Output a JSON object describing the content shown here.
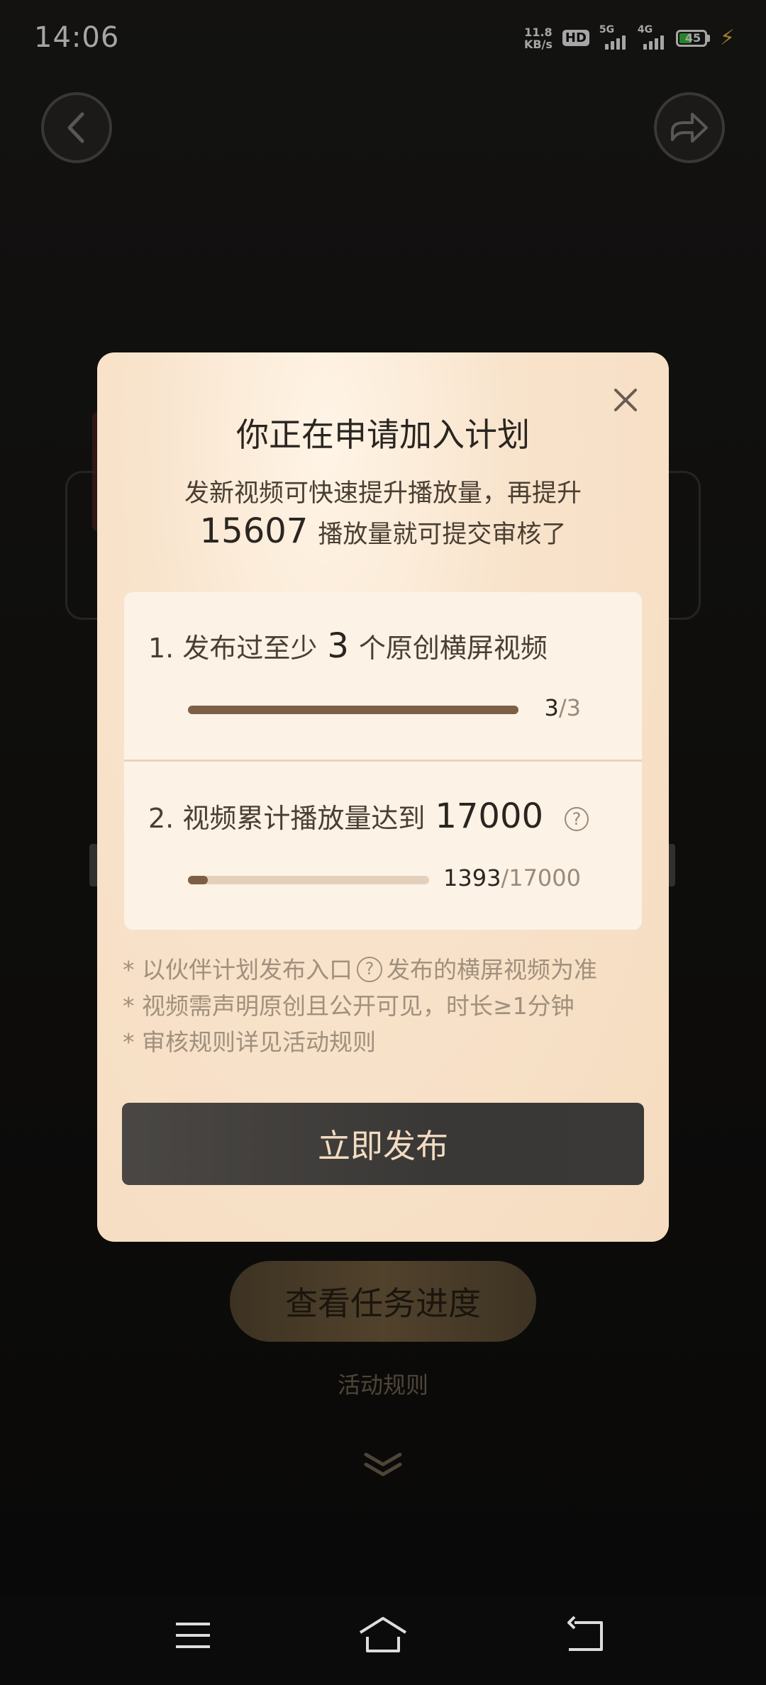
{
  "status_bar": {
    "time": "14:06",
    "net_speed_value": "11.8",
    "net_speed_unit": "KB/s",
    "hd_label": "HD",
    "sim1_label": "5G",
    "sim2_label": "4G",
    "battery_level": "45"
  },
  "background": {
    "task_progress_button": "查看任务进度",
    "rules_link": "活动规则"
  },
  "modal": {
    "title": "你正在申请加入计划",
    "subtitle_line1": "发新视频可快速提升播放量，再提升",
    "subtitle_remaining_views": "15607",
    "subtitle_line2_rest": "播放量就可提交审核了",
    "tasks": [
      {
        "prefix": "1. 发布过至少",
        "number": "3",
        "suffix": "个原创横屏视频",
        "progress_current": "3",
        "progress_total": "3",
        "progress_fraction": 1.0
      },
      {
        "prefix": "2. 视频累计播放量达到",
        "number": "17000",
        "suffix": "",
        "progress_current": "1393",
        "progress_total": "17000",
        "progress_fraction": 0.082
      }
    ],
    "notes": {
      "line1_before": "* 以伙伴计划发布入口",
      "line1_after": "发布的横屏视频为准",
      "line2": "* 视频需声明原创且公开可见，时长≥1分钟",
      "line3": "* 审核规则详见活动规则"
    },
    "publish_button": "立即发布"
  },
  "colors": {
    "modal_bg": "#f8e3cb",
    "progress_fill": "#7c5f45",
    "progress_track": "#e3d0bb",
    "publish_button_bg": "#3f3c3a",
    "publish_button_text": "#f3dcc1"
  },
  "icons": {
    "back": "chevron-left-icon",
    "share": "share-arrow-icon",
    "close": "close-icon",
    "help": "question-circle-icon",
    "expand": "double-chevron-down-icon",
    "nav_menu": "menu-icon",
    "nav_home": "home-icon",
    "nav_back": "back-icon"
  }
}
